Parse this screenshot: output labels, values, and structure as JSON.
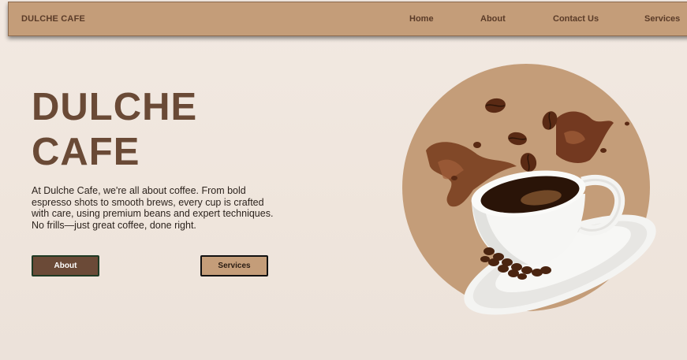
{
  "navbar": {
    "brand": "DULCHE CAFE",
    "links": [
      "Home",
      "About",
      "Contact Us",
      "Services"
    ]
  },
  "hero": {
    "title_line1": "DULCHE",
    "title_line2": "CAFE",
    "description": "At Dulche Cafe, we're all about coffee. From bold espresso shots to smooth brews, every cup is crafted with care, using premium beans and expert techniques. No frills—just great coffee, done right.",
    "about_button": "About",
    "services_button": "Services",
    "image_icon": "coffee-cup-image"
  },
  "colors": {
    "accent": "#c49d79",
    "dark_brown": "#6b4a37",
    "title": "#6a4a36",
    "background": "#f2e9e2"
  }
}
